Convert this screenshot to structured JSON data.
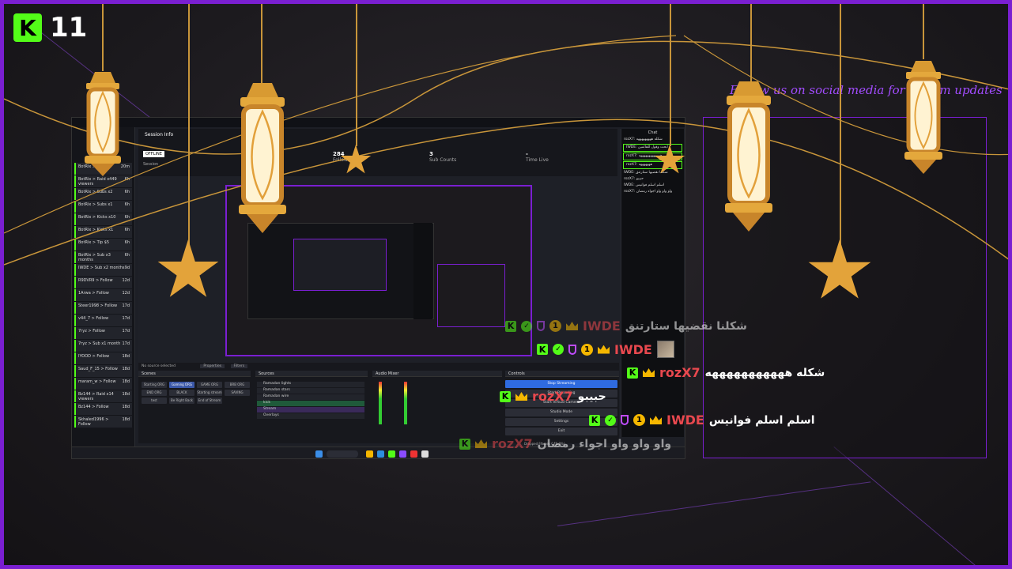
{
  "overlay": {
    "kick_logo": "K",
    "viewer_count": "11",
    "cta_text": "Follow us on social media for stream updates"
  },
  "screen": {
    "session_title": "Session Info",
    "session_label": "Session",
    "offline_badge": "OFFLINE",
    "stats": [
      {
        "value": "284",
        "label": "Followers"
      },
      {
        "value": "3",
        "label": "Sub Counts"
      },
      {
        "value": "-",
        "label": "Time Live"
      }
    ],
    "activity": [
      {
        "text": "BotRix > Follow",
        "time": "20m"
      },
      {
        "text": "BotRix > Raid x449 viewers",
        "time": "6h"
      },
      {
        "text": "BotRix > Subs x2",
        "time": "6h"
      },
      {
        "text": "BotRix > Subs x1",
        "time": "6h"
      },
      {
        "text": "BotRix > Kicks x10",
        "time": "6h"
      },
      {
        "text": "BotRix > Kicks x1",
        "time": "6h"
      },
      {
        "text": "BotRix > Tip $5",
        "time": "6h"
      },
      {
        "text": "BotRix > Sub x3 months",
        "time": "6h"
      },
      {
        "text": "IWDE > Sub x2 months",
        "time": "9d"
      },
      {
        "text": "R9DVR9 > Follow",
        "time": "12d"
      },
      {
        "text": "1Arwa > Follow",
        "time": "12d"
      },
      {
        "text": "Steer1998 > Follow",
        "time": "17d"
      },
      {
        "text": "v44_7 > Follow",
        "time": "17d"
      },
      {
        "text": "7ryz > Follow",
        "time": "17d"
      },
      {
        "text": "7ryz > Sub x1 month",
        "time": "17d"
      },
      {
        "text": "IYOOD > Follow",
        "time": "18d"
      },
      {
        "text": "Saud_F_15 > Follow",
        "time": "18d"
      },
      {
        "text": "maram_w > Follow",
        "time": "18d"
      },
      {
        "text": "Bz144 > Raid x14 viewers",
        "time": "18d"
      },
      {
        "text": "Bz144 > Follow",
        "time": "18d"
      },
      {
        "text": "Skhaled1996 > Follow",
        "time": "18d"
      }
    ],
    "scenes_header": "Scenes",
    "scenes": [
      "Starting ORG",
      "Gaming ORG",
      "GAME ORG",
      "BRB ORG",
      "END ORG",
      "BLACK",
      "Starting stream",
      "SAVING",
      "test",
      "Be Right Back",
      "End of Stream"
    ],
    "sources_header": "Sources",
    "sources": [
      "Ramadan lights",
      "Ramadan stars",
      "Ramadan wire",
      "kick",
      "Stream",
      "Overlays"
    ],
    "mixer_header": "Audio Mixer",
    "controls_header": "Controls",
    "controls": [
      "Stop Streaming",
      "Start Recording",
      "Start Virtual Camera",
      "Studio Mode",
      "Settings",
      "Exit"
    ],
    "chat_header": "Chat",
    "status_bar": "Dropped Frames 0 (0.0%)",
    "no_source": "No source selected",
    "properties": "Properties",
    "filters": "Filters"
  },
  "chat": [
    {
      "user": "IWDE",
      "text": "شكلنا نقضيها ستارتنق",
      "dim": true,
      "badges": [
        "k",
        "ver",
        "shield",
        "one",
        "crown"
      ],
      "color": "#e8484e"
    },
    {
      "user": "IWDE",
      "text": "",
      "dim": false,
      "badges": [
        "k",
        "ver",
        "shield",
        "one",
        "crown"
      ],
      "avatar": true,
      "color": "#e8484e"
    },
    {
      "user": "rozX7",
      "text": "شكله هههههههههههه",
      "dim": false,
      "badges": [
        "k",
        "crown"
      ],
      "color": "#e8484e"
    },
    {
      "user": "rozX7",
      "text": "حبيبو",
      "dim": false,
      "badges": [
        "k",
        "crown"
      ],
      "color": "#e8484e"
    },
    {
      "user": "IWDE",
      "text": "اسلم اسلم فوانيس",
      "dim": false,
      "badges": [
        "k",
        "ver",
        "shield",
        "one",
        "crown"
      ],
      "color": "#e8484e"
    },
    {
      "user": "rozX7",
      "text": "واو واو واو اجواء رمضان",
      "dim": true,
      "badges": [
        "k",
        "crown"
      ],
      "color": "#e8484e"
    }
  ],
  "colors": {
    "accent": "#7a1fd1",
    "kick": "#53fc18",
    "gold": "#e3a33a",
    "user": "#e8484e"
  }
}
